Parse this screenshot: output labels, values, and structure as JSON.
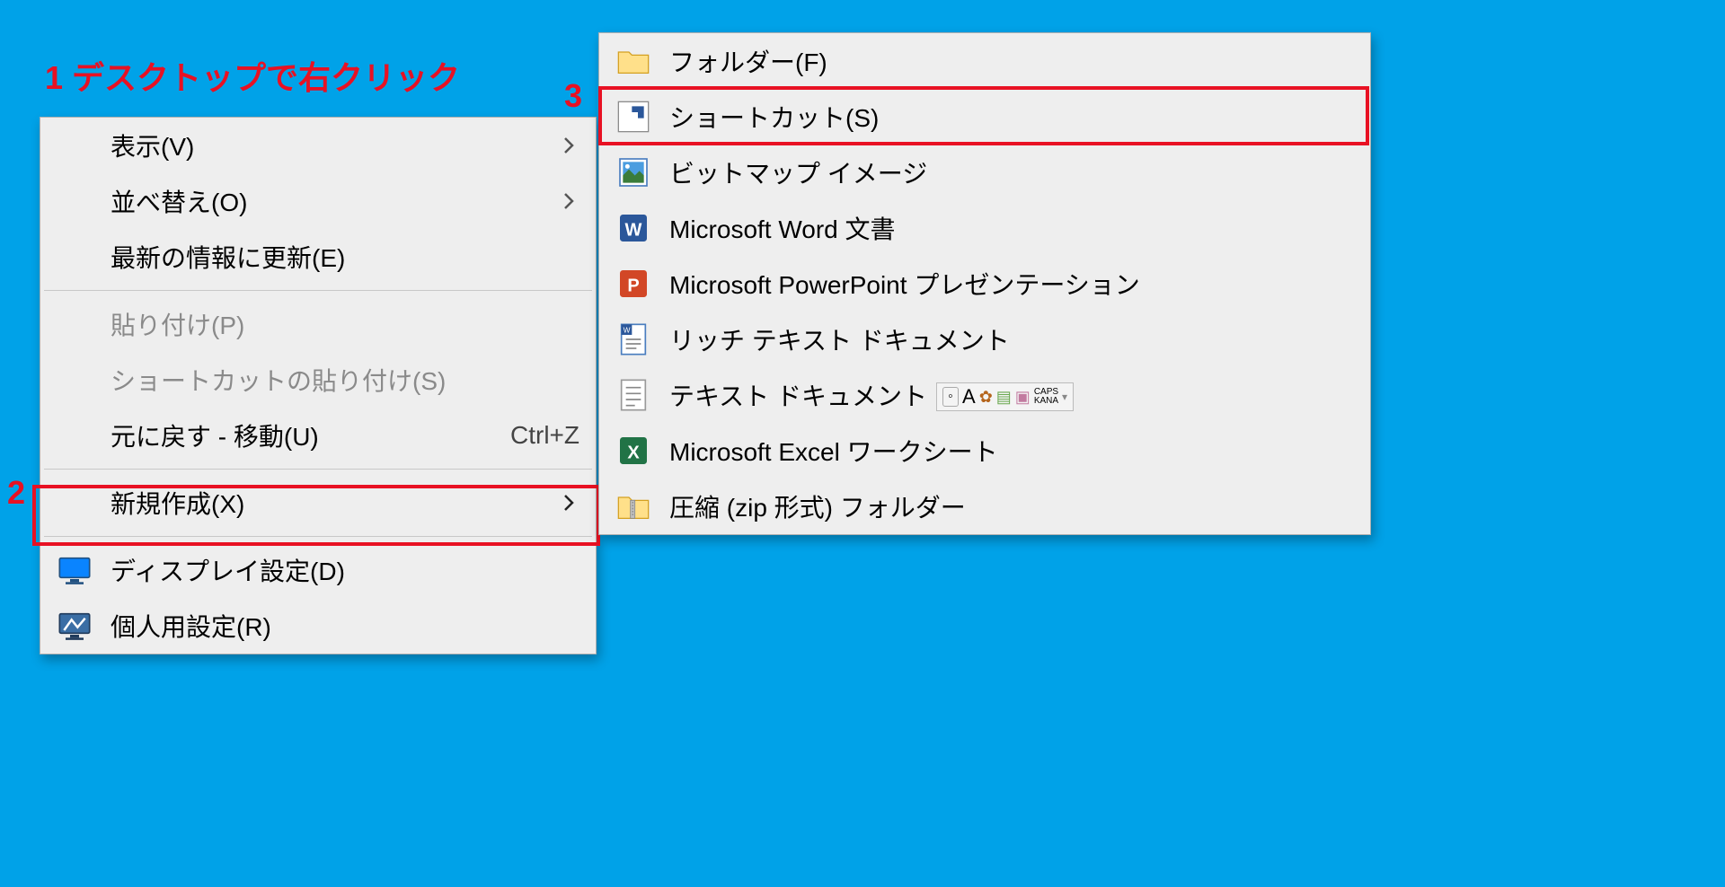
{
  "annotations": {
    "step1": "1 デスクトップで右クリック",
    "step2": "2",
    "step3": "3"
  },
  "contextMenu1": {
    "items": [
      {
        "label": "表示(V)",
        "hasSubmenu": true
      },
      {
        "label": "並べ替え(O)",
        "hasSubmenu": true
      },
      {
        "label": "最新の情報に更新(E)"
      }
    ],
    "items2": [
      {
        "label": "貼り付け(P)",
        "disabled": true
      },
      {
        "label": "ショートカットの貼り付け(S)",
        "disabled": true
      },
      {
        "label": "元に戻す - 移動(U)",
        "shortcut": "Ctrl+Z"
      }
    ],
    "items3": [
      {
        "label": "新規作成(X)",
        "hasSubmenu": true
      }
    ],
    "items4": [
      {
        "label": "ディスプレイ設定(D)",
        "icon": "display"
      },
      {
        "label": "個人用設定(R)",
        "icon": "personalize"
      }
    ]
  },
  "contextMenu2": {
    "items": [
      {
        "label": "フォルダー(F)",
        "icon": "folder"
      },
      {
        "label": "ショートカット(S)",
        "icon": "shortcut"
      },
      {
        "label": "ビットマップ イメージ",
        "icon": "bitmap"
      },
      {
        "label": "Microsoft Word 文書",
        "icon": "word"
      },
      {
        "label": "Microsoft PowerPoint プレゼンテーション",
        "icon": "powerpoint"
      },
      {
        "label": "リッチ テキスト ドキュメント",
        "icon": "rtf"
      },
      {
        "label": "テキスト ドキュメント",
        "icon": "text"
      },
      {
        "label": "Microsoft Excel ワークシート",
        "icon": "excel"
      },
      {
        "label": "圧縮 (zip 形式) フォルダー",
        "icon": "zip"
      }
    ]
  },
  "ime": {
    "labels": [
      "あ",
      "A",
      "CAPS",
      "KANA"
    ]
  }
}
